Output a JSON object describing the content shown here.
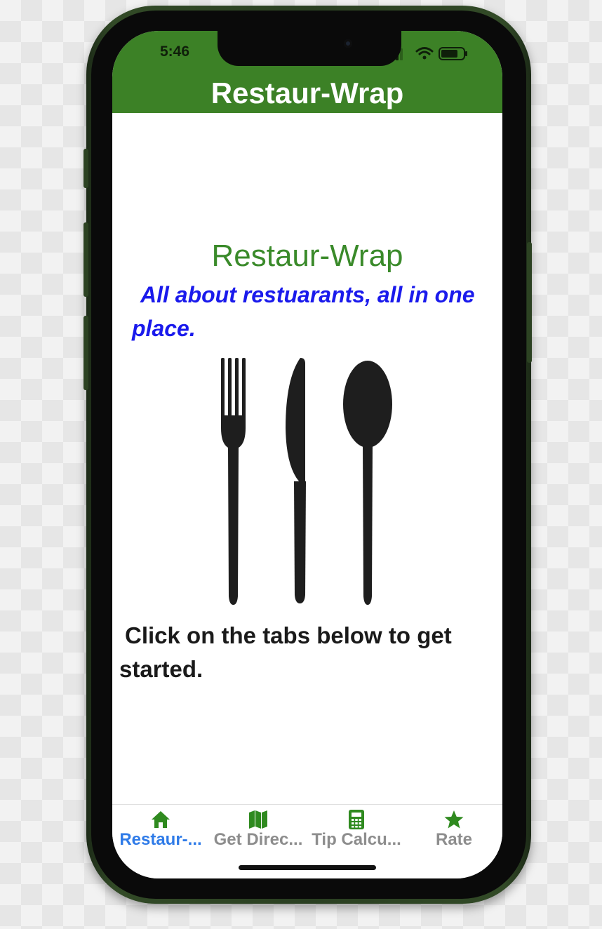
{
  "status_bar": {
    "time": "5:46",
    "icons": [
      "signal-icon",
      "wifi-icon",
      "battery-icon"
    ]
  },
  "header": {
    "title": "Restaur-Wrap",
    "background_color": "#3c8126"
  },
  "main": {
    "title": "Restaur-Wrap",
    "tagline": "All about restuarants, all in one place.",
    "illustration_icons": [
      "fork-icon",
      "knife-icon",
      "spoon-icon"
    ],
    "instructions": "Click on the tabs below to get started."
  },
  "tab_bar": {
    "active_color": "#2f7be8",
    "inactive_color": "#8d8d8d",
    "icon_color": "#2f8a1f",
    "tabs": [
      {
        "label": "Restaur-...",
        "icon": "home-icon",
        "active": true
      },
      {
        "label": "Get Direc...",
        "icon": "map-icon",
        "active": false
      },
      {
        "label": "Tip Calcu...",
        "icon": "calculator-icon",
        "active": false
      },
      {
        "label": "Rate",
        "icon": "star-icon",
        "active": false
      }
    ]
  }
}
